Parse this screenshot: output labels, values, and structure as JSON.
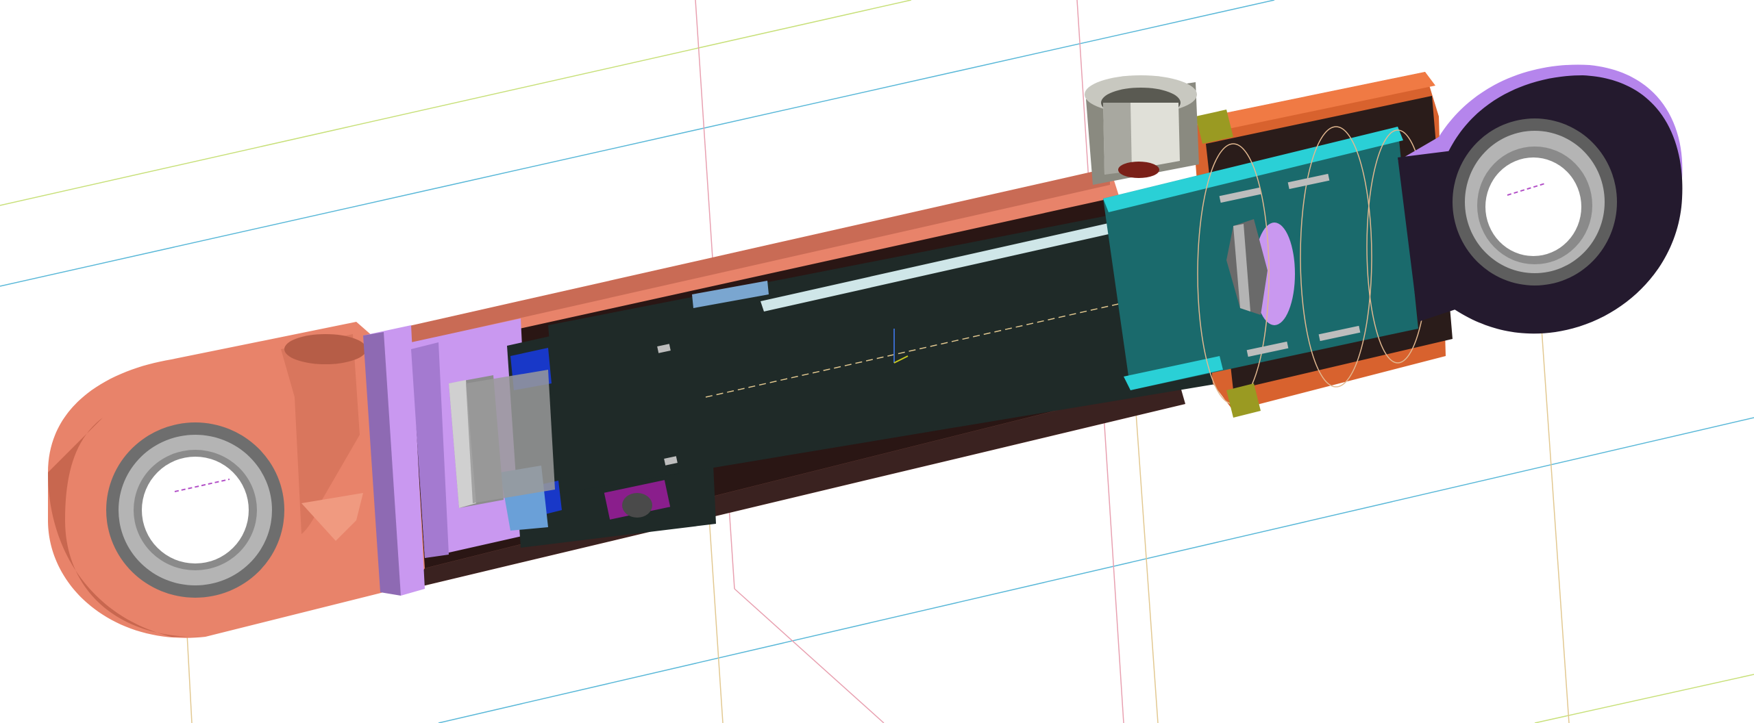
{
  "viewport": {
    "kind": "3d-cad-section-view",
    "background": "#ffffff"
  },
  "model": {
    "subject": "hydraulic-cylinder-cutaway",
    "colors": {
      "barrel_body": "#e8836a",
      "barrel_dark": "#2a1614",
      "end_cap": "#c998f0",
      "end_cap_dark": "#8e6ab3",
      "rod": "#1f2a28",
      "rod_highlight": "#cfe6e8",
      "gland_cyan": "#2ad0d6",
      "seal_purple": "#8a1e8c",
      "seal_blue": "#1838c8",
      "bearing_grey": "#a8a8a8",
      "rod_eye_dark": "#241a2e",
      "rod_eye_lilac": "#b585ec",
      "gland_orange": "#d8622e",
      "nut_olive": "#9a9a22",
      "port_grey": "#8a8a80"
    },
    "reference_line_colors": {
      "yellow_green": "#c8e07a",
      "cyan": "#5ab8d8",
      "pink": "#e8a0b0",
      "tan": "#e2c890"
    }
  }
}
